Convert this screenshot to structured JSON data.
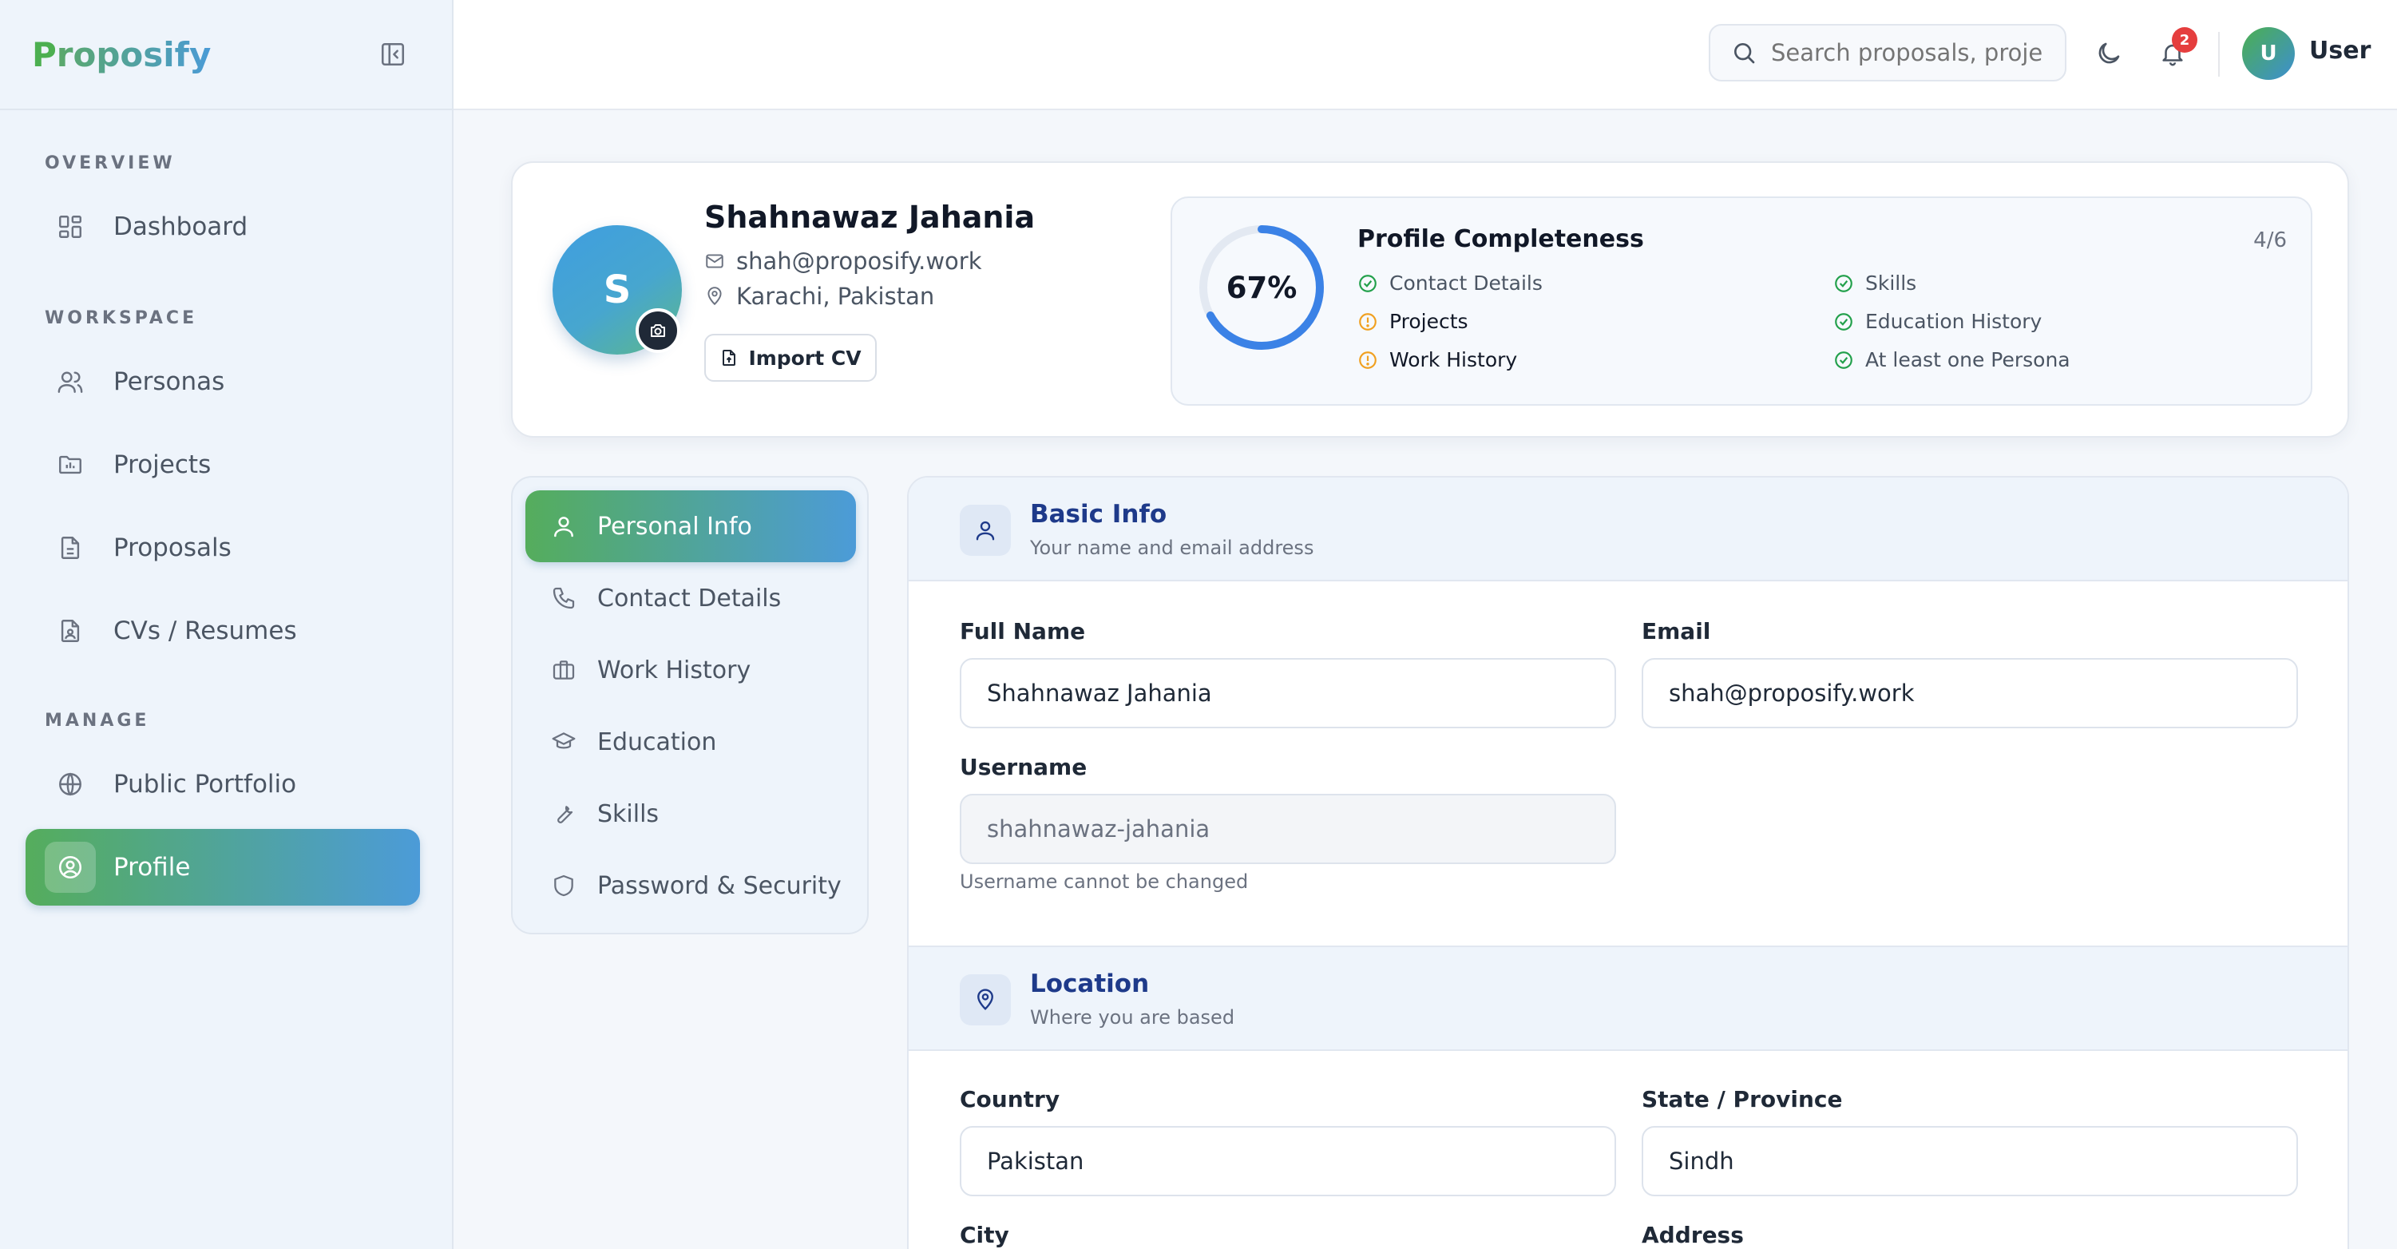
{
  "brand": {
    "first_letter": "P",
    "rest": "roposify"
  },
  "sidebar": {
    "sections": [
      "OVERVIEW",
      "WORKSPACE",
      "MANAGE"
    ],
    "items": [
      {
        "label": "Dashboard",
        "icon": "dashboard-icon"
      },
      {
        "label": "Personas",
        "icon": "users-icon"
      },
      {
        "label": "Projects",
        "icon": "folder-chart-icon"
      },
      {
        "label": "Proposals",
        "icon": "document-icon"
      },
      {
        "label": "CVs / Resumes",
        "icon": "file-user-icon"
      },
      {
        "label": "Public Portfolio",
        "icon": "globe-icon"
      },
      {
        "label": "Profile",
        "icon": "user-circle-icon",
        "active": true
      }
    ]
  },
  "header": {
    "search_placeholder": "Search proposals, projects...",
    "notification_count": "2",
    "user_initial": "U",
    "user_name": "User"
  },
  "profile": {
    "avatar_initial": "S",
    "name": "Shahnawaz Jahania",
    "email": "shah@proposify.work",
    "location": "Karachi, Pakistan",
    "import_label": "Import CV"
  },
  "completeness": {
    "title": "Profile Completeness",
    "percent": 67,
    "percent_label": "67%",
    "count": "4/6",
    "items": [
      {
        "label": "Contact Details",
        "done": true
      },
      {
        "label": "Projects",
        "done": false
      },
      {
        "label": "Work History",
        "done": false
      },
      {
        "label": "Skills",
        "done": true
      },
      {
        "label": "Education History",
        "done": true
      },
      {
        "label": "At least one Persona",
        "done": true
      }
    ]
  },
  "tabs": [
    {
      "label": "Personal Info",
      "active": true
    },
    {
      "label": "Contact Details"
    },
    {
      "label": "Work History"
    },
    {
      "label": "Education"
    },
    {
      "label": "Skills"
    },
    {
      "label": "Password & Security"
    }
  ],
  "form": {
    "basic": {
      "title": "Basic Info",
      "subtitle": "Your name and email address",
      "full_name_label": "Full Name",
      "full_name_value": "Shahnawaz Jahania",
      "email_label": "Email",
      "email_value": "shah@proposify.work",
      "username_label": "Username",
      "username_value": "shahnawaz-jahania",
      "username_hint": "Username cannot be changed"
    },
    "location": {
      "title": "Location",
      "subtitle": "Where you are based",
      "country_label": "Country",
      "country_value": "Pakistan",
      "state_label": "State / Province",
      "state_value": "Sindh",
      "city_label": "City",
      "address_label": "Address"
    }
  },
  "colors": {
    "accent_green": "#55ad5c",
    "accent_blue": "#4c9bd8",
    "success": "#22a04b",
    "warning": "#f0a020",
    "section_title": "#1e3a8a"
  }
}
